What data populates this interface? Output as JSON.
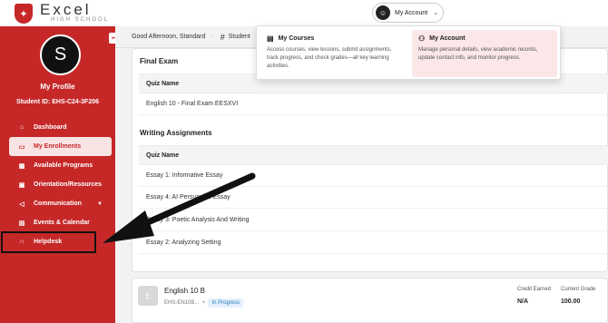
{
  "brand": {
    "name": "Excel",
    "tagline": "HIGH SCHOOL",
    "logo_icon": "shield-icon"
  },
  "account_menu": {
    "label": "My Account",
    "avatar_icon": "user-account-icon",
    "chevron_icon": "chevron-down-icon"
  },
  "sidebar": {
    "avatar_initial": "S",
    "profile_title": "My Profile",
    "student_id": "Student ID: EHS-C24-3F206",
    "items": [
      {
        "label": "Dashboard",
        "icon": "home-icon",
        "glyph": "⌂"
      },
      {
        "label": "My Enrollments",
        "icon": "book-icon",
        "glyph": "▭",
        "active": true
      },
      {
        "label": "Available Programs",
        "icon": "grid-icon",
        "glyph": "▦"
      },
      {
        "label": "Orientation/Resources",
        "icon": "briefcase-icon",
        "glyph": "▣"
      },
      {
        "label": "Communication",
        "icon": "megaphone-icon",
        "glyph": "◁",
        "has_chevron": true
      },
      {
        "label": "Events & Calendar",
        "icon": "calendar-icon",
        "glyph": "▤"
      },
      {
        "label": "Helpdesk",
        "icon": "headset-icon",
        "glyph": "∩"
      }
    ]
  },
  "header": {
    "greeting": "Good Afternoon, Standard",
    "breadcrumb": "Student"
  },
  "final_exam": {
    "title": "Final Exam",
    "column_header": "Quiz Name",
    "rows": [
      "English 10 - Final Exam EESXVI"
    ]
  },
  "writing_assignments": {
    "title": "Writing Assignments",
    "column_header": "Quiz Name",
    "rows": [
      "Essay 1: Informative Essay",
      "Essay 4: AI Persuasive Essay",
      "Essay 3: Poetic Analysis And Writing",
      "Essay 2: Analyzing Setting"
    ]
  },
  "course": {
    "badge": "E",
    "title": "English 10 B",
    "code": "EHS-EN10B...",
    "status": "In Progress",
    "credit_label": "Credit Earned",
    "credit_value": "N/A",
    "grade_label": "Current Grade",
    "grade_value": "100.00"
  },
  "dropdown": {
    "courses": {
      "title": "My Courses",
      "icon": "book-open-icon",
      "description": "Access courses, view lessons, submit assignments, track progress, and check grades—all key learning activities."
    },
    "account": {
      "title": "My Account",
      "icon": "user-settings-icon",
      "description": "Manage personal details, view academic records, update contact info, and monitor progress."
    }
  },
  "colors": {
    "brand_red": "#c62828",
    "active_bg": "#f9e3e3",
    "dropdown_highlight": "#fbe7e7",
    "status_blue": "#2a7bc0"
  }
}
